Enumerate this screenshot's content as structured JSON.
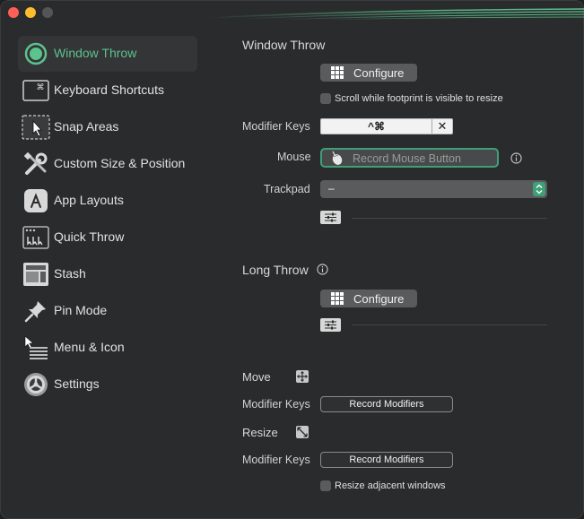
{
  "sidebar": {
    "items": [
      {
        "label": "Window Throw",
        "icon": "window-throw-icon",
        "active": true
      },
      {
        "label": "Keyboard Shortcuts",
        "icon": "keyboard-shortcut-icon"
      },
      {
        "label": "Snap Areas",
        "icon": "snap-areas-icon"
      },
      {
        "label": "Custom Size & Position",
        "icon": "tools-icon"
      },
      {
        "label": "App Layouts",
        "icon": "app-layouts-icon"
      },
      {
        "label": "Quick Throw",
        "icon": "quick-throw-icon"
      },
      {
        "label": "Stash",
        "icon": "stash-icon"
      },
      {
        "label": "Pin Mode",
        "icon": "pushpin-icon"
      },
      {
        "label": "Menu & Icon",
        "icon": "menu-icon"
      },
      {
        "label": "Settings",
        "icon": "gear-icon"
      }
    ]
  },
  "window_throw": {
    "title": "Window Throw",
    "configure_label": "Configure",
    "scroll_checkbox_label": "Scroll while footprint is visible to resize",
    "modifier_keys_label": "Modifier Keys",
    "modifier_keys_value": "^⌘",
    "clear_symbol": "✕",
    "mouse_label": "Mouse",
    "mouse_placeholder": "Record Mouse Button",
    "trackpad_label": "Trackpad",
    "trackpad_value": "–"
  },
  "long_throw": {
    "title": "Long Throw",
    "configure_label": "Configure"
  },
  "move": {
    "title": "Move",
    "modifier_keys_label": "Modifier Keys",
    "record_label": "Record Modifiers"
  },
  "resize": {
    "title": "Resize",
    "modifier_keys_label": "Modifier Keys",
    "record_label": "Record Modifiers",
    "adjacent_checkbox_label": "Resize adjacent windows"
  },
  "colors": {
    "accent": "#5cc28e",
    "accent_border": "#3fa077",
    "window_bg": "#2a2b2c"
  }
}
